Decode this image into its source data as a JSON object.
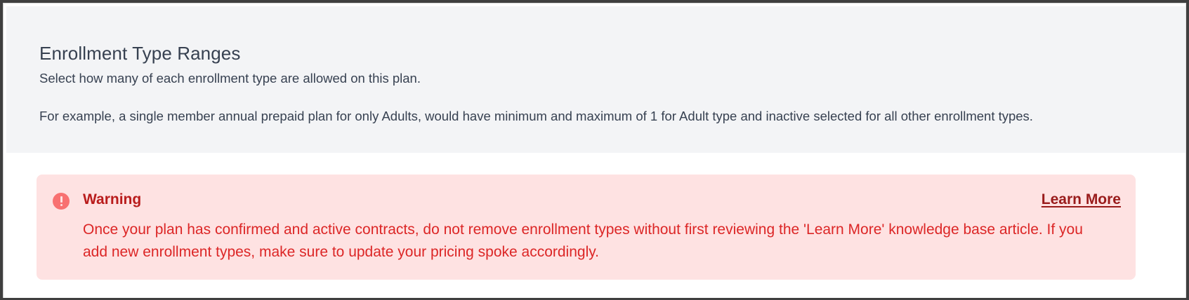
{
  "header": {
    "title": "Enrollment Type Ranges",
    "subtitle": "Select how many of each enrollment type are allowed on this plan.",
    "example": "For example, a single member annual prepaid plan for only Adults, would have minimum and maximum of 1 for Adult type and inactive selected for all other enrollment types."
  },
  "warning": {
    "icon": "exclamation-circle-icon",
    "title": "Warning",
    "link_label": "Learn More",
    "message": "Once your plan has confirmed and active contracts, do not remove enrollment types without first reviewing the 'Learn More' knowledge base article. If you add new enrollment types, make sure to update your pricing spoke accordingly."
  },
  "colors": {
    "panel_bg": "#f3f4f6",
    "warning_bg": "#fee2e2",
    "warning_icon": "#f87171",
    "warning_title": "#b91c1c",
    "warning_link": "#991b1b",
    "warning_text": "#dc2626",
    "heading_text": "#374151"
  }
}
